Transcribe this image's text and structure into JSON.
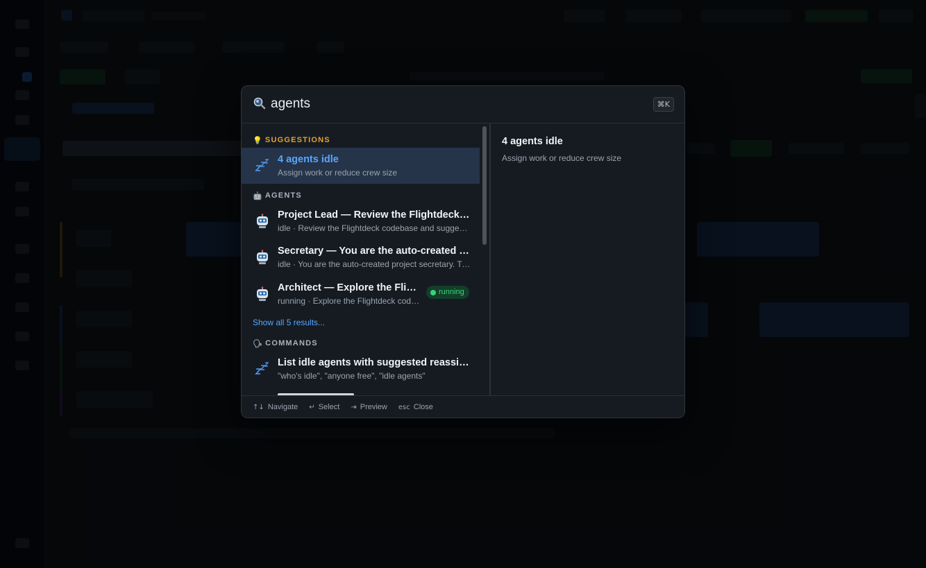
{
  "palette": {
    "search": {
      "value": "agents",
      "shortcut": "⌘K",
      "icon": "magnifier-icon"
    },
    "sections": {
      "suggestions": {
        "emoji": "💡",
        "label": "SUGGESTIONS"
      },
      "agents": {
        "emoji": "🤖",
        "label": "AGENTS"
      },
      "commands": {
        "emoji": "🗣",
        "label": "COMMANDS"
      }
    },
    "suggestions": [
      {
        "icon": "zzz-icon",
        "title": "4 agents idle",
        "subtitle": "Assign work or reduce crew size",
        "selected": true
      }
    ],
    "agents": [
      {
        "icon": "robot-icon",
        "title": "Project Lead — Review the Flightdeck codebase and suggest improvements",
        "subtitle": "idle · Review the Flightdeck codebase and suggest improvements"
      },
      {
        "icon": "robot-icon",
        "title": "Secretary — You are the auto-created project secretary",
        "subtitle": "idle · You are the auto-created project secretary. Track progress"
      },
      {
        "icon": "robot-icon",
        "title": "Architect — Explore the Flightdeck codebase",
        "subtitle": "running · Explore the Flightdeck codebase",
        "badge": "running"
      }
    ],
    "show_all": "Show all 5 results...",
    "commands": [
      {
        "icon": "zzz-icon",
        "title": "List idle agents with suggested reassignments",
        "subtitle": "\"who's idle\", \"anyone free\", \"idle agents\""
      }
    ],
    "preview": {
      "title": "4 agents idle",
      "description": "Assign work or reduce crew size"
    },
    "footer": [
      {
        "keys": "↑↓",
        "label": "Navigate"
      },
      {
        "keys": "↵",
        "label": "Select"
      },
      {
        "keys": "⇥",
        "label": "Preview"
      },
      {
        "keys": "esc",
        "label": "Close"
      }
    ]
  },
  "colors": {
    "accent": "#58a6ff",
    "suggestion_header": "#e3a230",
    "running": "#3fd07a",
    "panel": "#161b22"
  }
}
